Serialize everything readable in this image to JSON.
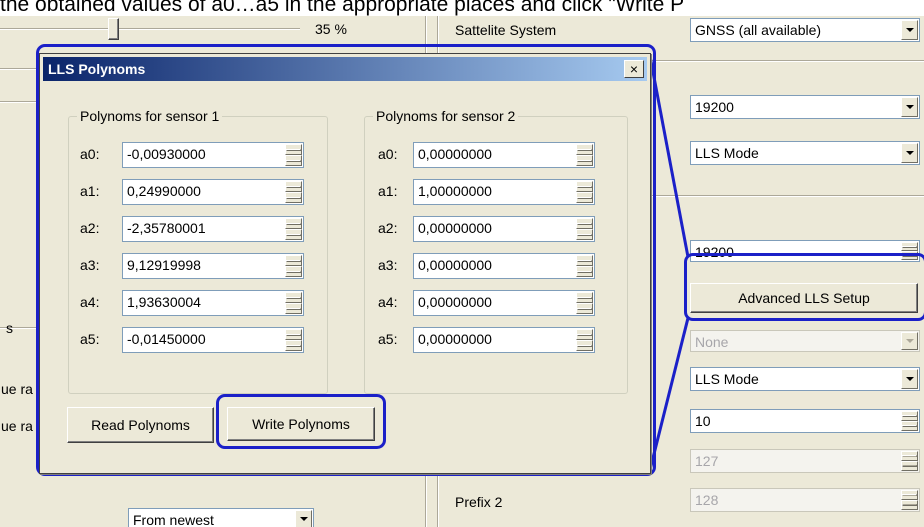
{
  "caption": "the obtained values of a0…a5 in the appropriate places and click \"Write P",
  "background": {
    "zoom_value": "35 %",
    "satellite_label": "Sattelite System",
    "satellite_value": "GNSS (all available)",
    "baud_value": "19200",
    "mode_value_1": "LLS Mode",
    "baud_value_2": "19200",
    "advanced_button": "Advanced LLS Setup",
    "none_value": "None",
    "mode_value_2": "LLS Mode",
    "spin_value_10": "10",
    "spin_value_127": "127",
    "prefix2_label": "Prefix 2",
    "spin_value_128": "128",
    "order_value": "From newest",
    "left_label_s": "s",
    "left_label_ra1": "ue ra",
    "left_label_ra2": "ue ra"
  },
  "dialog": {
    "title": "LLS Polynoms",
    "close_label": "×",
    "sensor1": {
      "title": "Polynoms for sensor 1",
      "rows": [
        {
          "label": "a0:",
          "value": "-0,00930000"
        },
        {
          "label": "a1:",
          "value": "0,24990000"
        },
        {
          "label": "a2:",
          "value": "-2,35780001"
        },
        {
          "label": "a3:",
          "value": "9,12919998"
        },
        {
          "label": "a4:",
          "value": "1,93630004"
        },
        {
          "label": "a5:",
          "value": "-0,01450000"
        }
      ]
    },
    "sensor2": {
      "title": "Polynoms for sensor 2",
      "rows": [
        {
          "label": "a0:",
          "value": "0,00000000"
        },
        {
          "label": "a1:",
          "value": "1,00000000"
        },
        {
          "label": "a2:",
          "value": "0,00000000"
        },
        {
          "label": "a3:",
          "value": "0,00000000"
        },
        {
          "label": "a4:",
          "value": "0,00000000"
        },
        {
          "label": "a5:",
          "value": "0,00000000"
        }
      ]
    },
    "read_button": "Read Polynoms",
    "write_button": "Write Polynoms"
  },
  "colors": {
    "highlight": "#1b20c8",
    "titlebar_start": "#0a246a",
    "titlebar_end": "#a6caf0",
    "window_bg": "#ece9d8"
  }
}
